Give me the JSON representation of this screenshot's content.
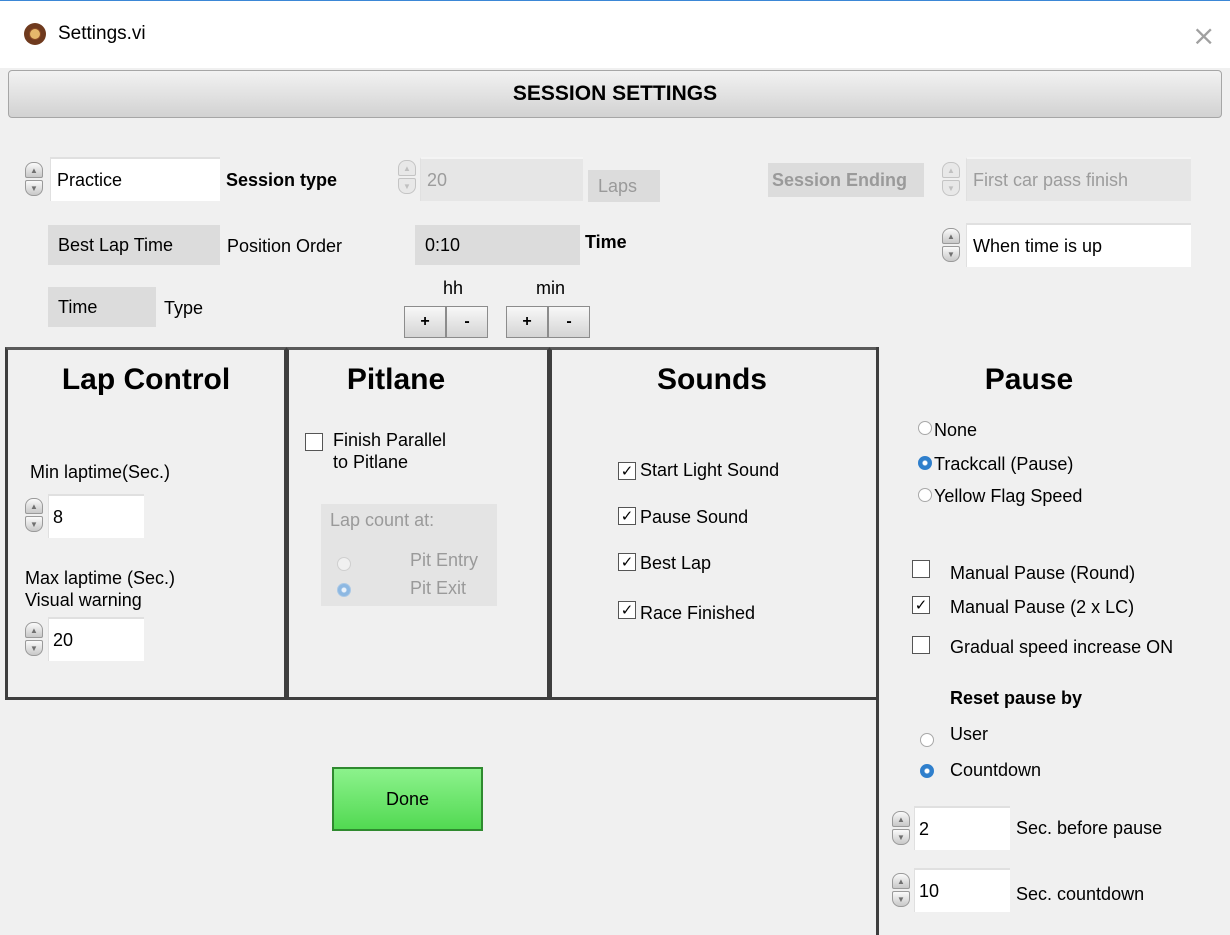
{
  "window": {
    "title": "Settings.vi",
    "close": "×"
  },
  "banner": "SESSION SETTINGS",
  "session": {
    "type_value": "Practice",
    "type_label": "Session type",
    "laps_value": "20",
    "laps_label": "Laps",
    "ending_label": "Session Ending",
    "ending_value": "First car pass finish",
    "when_value": "When time is up",
    "order_value": "Best Lap Time",
    "order_label": "Position Order",
    "time_value": "0:10",
    "time_label": "Time",
    "type2_value": "Time",
    "type2_label": "Type",
    "hh_label": "hh",
    "min_label": "min",
    "plus": "+",
    "minus": "-"
  },
  "lap_control": {
    "heading": "Lap Control",
    "min_label": "Min laptime(Sec.)",
    "min_value": "8",
    "max_label_1": "Max laptime (Sec.)",
    "max_label_2": "Visual warning",
    "max_value": "20"
  },
  "pitlane": {
    "heading": "Pitlane",
    "finish_label_1": "Finish Parallel",
    "finish_label_2": "to Pitlane",
    "finish_checked": false,
    "count_label": "Lap count at:",
    "entry_label": "Pit Entry",
    "exit_label": "Pit Exit"
  },
  "sounds": {
    "heading": "Sounds",
    "items": [
      "Start Light Sound",
      "Pause Sound",
      "Best Lap",
      "Race Finished"
    ],
    "check": "✓"
  },
  "pause": {
    "heading": "Pause",
    "modes": [
      "None",
      "Trackcall (Pause)",
      "Yellow Flag Speed"
    ],
    "selected_mode": "Trackcall (Pause)",
    "options": [
      {
        "label": "Manual Pause  (Round)",
        "checked": false
      },
      {
        "label": "Manual Pause (2 x LC)",
        "checked": true
      },
      {
        "label": "Gradual speed increase ON",
        "checked": false
      }
    ],
    "reset_label": "Reset pause by",
    "reset_options": [
      "User",
      "Countdown"
    ],
    "selected_reset": "Countdown",
    "before_value": "2",
    "before_label": "Sec. before pause",
    "countdown_value": "10",
    "countdown_label": "Sec. countdown"
  },
  "done_label": "Done"
}
